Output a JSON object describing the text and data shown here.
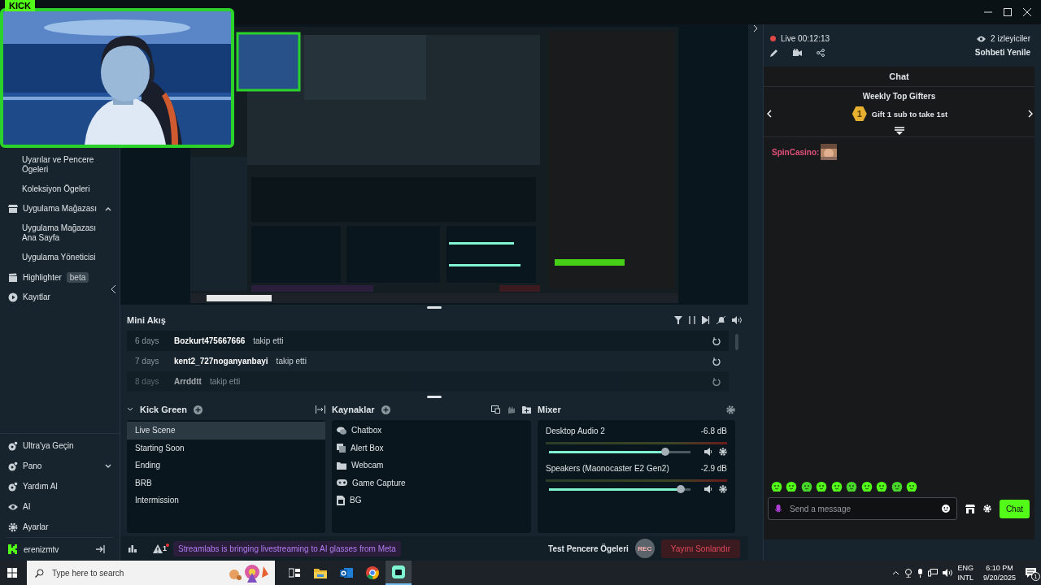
{
  "window": {
    "badge": "KICK"
  },
  "sidebar": {
    "items": [
      {
        "label": "Uyarılar ve Pencere Ögeleri",
        "kind": "sub"
      },
      {
        "label": "Koleksiyon Ögeleri",
        "kind": "sub"
      },
      {
        "label": "Uygulama Mağazası",
        "kind": "group",
        "expanded": true
      },
      {
        "label": "Uygulama Mağazası Ana Sayfa",
        "kind": "sub"
      },
      {
        "label": "Uygulama Yöneticisi",
        "kind": "sub"
      },
      {
        "label": "Highlighter",
        "kind": "item",
        "badge": "beta"
      },
      {
        "label": "Kayıtlar",
        "kind": "item"
      }
    ],
    "bottom_items": [
      {
        "label": "Ultra'ya Geçin"
      },
      {
        "label": "Pano",
        "expanded": false
      },
      {
        "label": "Yardım Al"
      },
      {
        "label": "AI"
      },
      {
        "label": "Ayarlar"
      }
    ],
    "account": "erenizmtv"
  },
  "activity": {
    "title": "Mini Akış",
    "events": [
      {
        "time": "6 days",
        "user": "Bozkurt475667666",
        "action": "takip etti"
      },
      {
        "time": "7 days",
        "user": "kent2_727noganyanbayi",
        "action": "takip etti"
      },
      {
        "time": "8 days",
        "user": "Arrddtt",
        "action": "takip etti"
      }
    ]
  },
  "scenes": {
    "title": "Kick Green",
    "items": [
      {
        "label": "Live Scene",
        "selected": true
      },
      {
        "label": "Starting Soon",
        "selected": false
      },
      {
        "label": "Ending",
        "selected": false
      },
      {
        "label": "BRB",
        "selected": false
      },
      {
        "label": "Intermission",
        "selected": false
      }
    ]
  },
  "sources": {
    "title": "Kaynaklar",
    "items": [
      {
        "label": "Chatbox",
        "kind": "chat"
      },
      {
        "label": "Alert Box",
        "kind": "alert"
      },
      {
        "label": "Webcam",
        "kind": "folder"
      },
      {
        "label": "Game Capture",
        "kind": "game"
      },
      {
        "label": "BG"
      }
    ]
  },
  "mixer": {
    "title": "Mixer",
    "channels": [
      {
        "name": "Desktop Audio 2",
        "reading": "-6.8 dB",
        "level": 0.82
      },
      {
        "name": "Speakers (Maonocaster E2 Gen2)",
        "reading": "-2.9 dB",
        "level": 0.93
      }
    ]
  },
  "footer": {
    "alert_count": "1",
    "news": "Streamlabs is bringing livestreaming to AI glasses from Meta",
    "test_label": "Test Pencere Ögeleri",
    "rec": "REC",
    "end_button": "Yayını Sonlandır"
  },
  "chat": {
    "live": "Live 00:12:13",
    "viewers": "2 izleyiciler",
    "refresh": "Sohbeti Yenile",
    "title": "Chat",
    "gifters_title": "Weekly Top Gifters",
    "rank": "1",
    "gift_text": "Gift 1 sub to take 1st",
    "messages": [
      {
        "user": "SpinCasino:"
      }
    ],
    "placeholder": "Send a message",
    "send_button": "Chat"
  },
  "taskbar": {
    "placeholder": "Type here to search",
    "apps": [
      {
        "kind": "taskview",
        "selected": false
      },
      {
        "kind": "explorer",
        "selected": false
      },
      {
        "kind": "mail",
        "selected": false
      },
      {
        "kind": "browser",
        "selected": false
      },
      {
        "kind": "streamlabs",
        "selected": true
      }
    ],
    "lang": "ENG",
    "layout": "INTL",
    "time": "6:10 PM",
    "date": "9/20/2025",
    "notifications": "1"
  }
}
